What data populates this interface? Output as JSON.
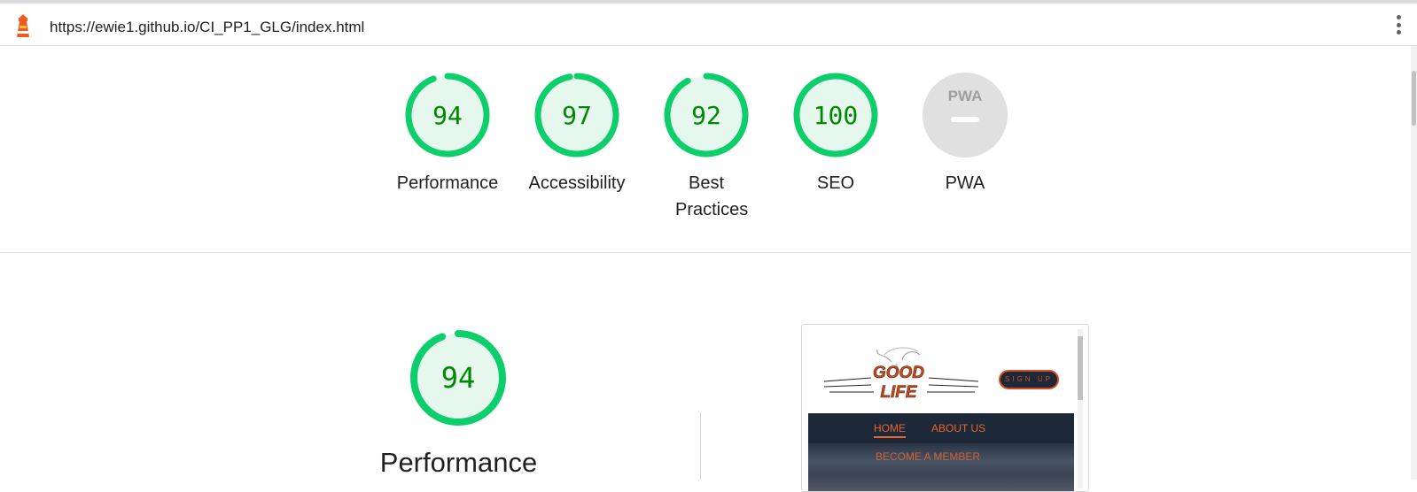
{
  "browser": {
    "url": "https://ewie1.github.io/CI_PP1_GLG/index.html",
    "menu_icon": "kebab-menu-icon",
    "logo_icon": "lighthouse-icon"
  },
  "colors": {
    "pass": "#0cce6b",
    "pass_fill": "#e6f8ee",
    "pass_text": "#008800",
    "na": "#e0e0e0",
    "accent_orange": "#e8662f",
    "site_navy": "#1d2838"
  },
  "gauges": [
    {
      "label": "Performance",
      "score": 94
    },
    {
      "label": "Accessibility",
      "score": 97
    },
    {
      "label": "Best Practices",
      "score": 92
    },
    {
      "label": "SEO",
      "score": 100
    },
    {
      "label": "PWA",
      "badge": "PWA",
      "score": null
    }
  ],
  "performance": {
    "score": 94,
    "title": "Performance"
  },
  "screenshot": {
    "logo_line1": "GOOD",
    "logo_line2": "LIFE",
    "signup_label": "SIGN UP",
    "nav": [
      "HOME",
      "ABOUT US"
    ],
    "hero_text": "BECOME A MEMBER"
  }
}
